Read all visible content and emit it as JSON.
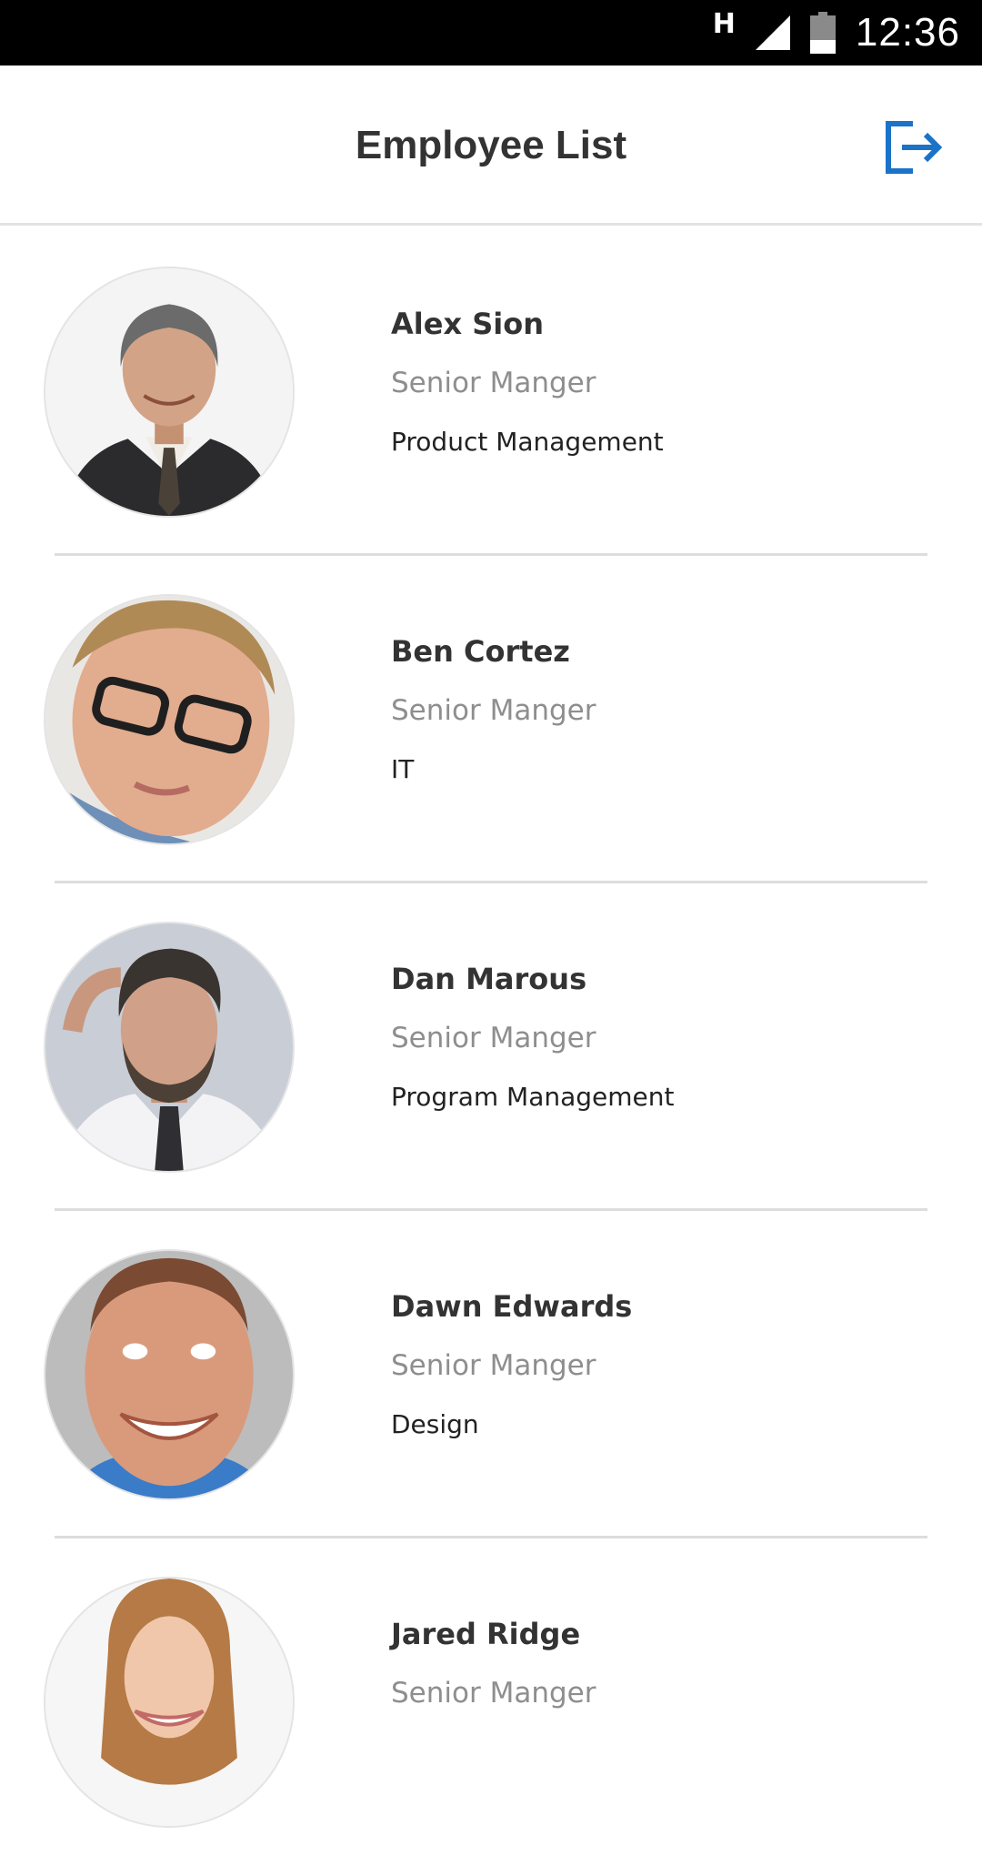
{
  "status_bar": {
    "network_type": "H",
    "time": "12:36",
    "icons": [
      "signal-icon",
      "battery-icon"
    ]
  },
  "header": {
    "title": "Employee List",
    "logout_icon": "logout-icon"
  },
  "colors": {
    "accent": "#1a73c8",
    "title_text": "#333333",
    "secondary_text": "#8e8e8e",
    "divider": "#dddddd"
  },
  "employees": [
    {
      "name": "Alex Sion",
      "title": "Senior Manger",
      "department": "Product Management"
    },
    {
      "name": "Ben Cortez",
      "title": "Senior Manger",
      "department": "IT"
    },
    {
      "name": "Dan Marous",
      "title": "Senior Manger",
      "department": "Program Management"
    },
    {
      "name": "Dawn Edwards",
      "title": "Senior Manger",
      "department": "Design"
    },
    {
      "name": "Jared Ridge",
      "title": "Senior Manger",
      "department": ""
    }
  ]
}
